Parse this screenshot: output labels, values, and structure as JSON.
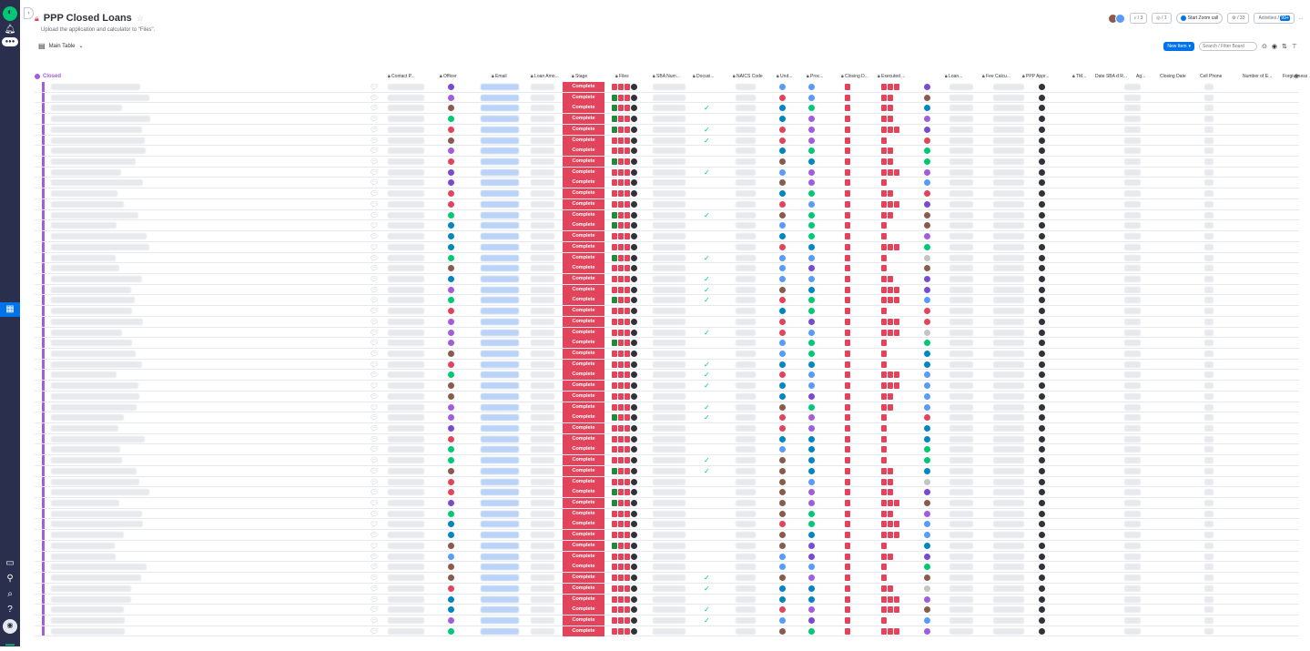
{
  "board": {
    "title": "PPP Closed Loans",
    "description": "Upload the application and calculator to \"Files\".",
    "view_name": "Main Table"
  },
  "toolbar": {
    "search_count": "/ 3",
    "subscribers_count": "/ 1",
    "zoom_label": "Start Zoom call",
    "integrations_count": "/ 33",
    "activities_label": "Activities",
    "activities_count": "99+",
    "more_label": "...",
    "new_item_label": "New Item",
    "search_placeholder": "Search / Filter Board"
  },
  "group": {
    "name": "Closed"
  },
  "columns": [
    "Contact P...",
    "Officer",
    "Email",
    "Loan Amo...",
    "Stage",
    "Files",
    "SBA Num...",
    "Docusi...",
    "NAICS Code",
    "Und...",
    "Proc...",
    "Closing D...",
    "Executed ...",
    "Loan...",
    "Fee Calcu...",
    "PPP Appr...",
    "TM...",
    "Date SBA d R...",
    "Ag...",
    "Closing Date",
    "Cell Phone",
    "Number of E...",
    "Forgiveness ..."
  ],
  "stage_label": "Complete",
  "colors": {
    "accent": "#0073ea",
    "group": "#a25ddc",
    "stage_complete": "#e2445c",
    "rail": "#292f4c"
  },
  "icons": [
    "monday-logo-icon",
    "bell-icon",
    "inbox-icon",
    "boards-icon",
    "calendar-icon",
    "person-icon",
    "search-icon",
    "help-icon",
    "lock-icon",
    "star-icon",
    "chat-icon",
    "check-icon",
    "pdf-file-icon",
    "plus-icon"
  ]
}
